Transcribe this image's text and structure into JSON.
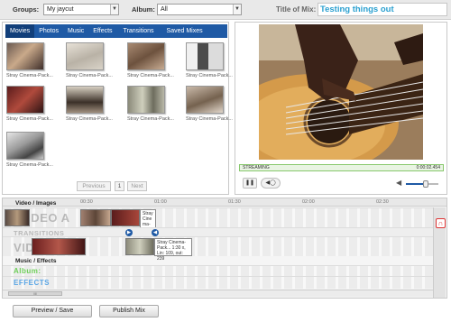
{
  "header": {
    "groups_label": "Groups:",
    "groups_value": "My jaycut",
    "album_label": "Album:",
    "album_value": "All",
    "mix_title_label": "Title of Mix:",
    "mix_title_value": "Testing things out"
  },
  "library": {
    "tabs": [
      "Movies",
      "Photos",
      "Music",
      "Effects",
      "Transitions",
      "Saved Mixes"
    ],
    "active_tab": "Movies",
    "items": [
      {
        "caption": "Stray Cinema-Pack..."
      },
      {
        "caption": "Stray Cinema-Pack..."
      },
      {
        "caption": "Stray Cinema-Pack..."
      },
      {
        "caption": "Stray Cinema-Pack..."
      },
      {
        "caption": "Stray Cinema-Pack..."
      },
      {
        "caption": "Stray Cinema-Pack..."
      },
      {
        "caption": "Stray Cinema-Pack..."
      },
      {
        "caption": "Stray Cinema-Pack..."
      },
      {
        "caption": "Stray Cinema-Pack..."
      }
    ],
    "pager": {
      "previous": "Previous",
      "page": "1",
      "next": "Next"
    }
  },
  "preview": {
    "status": "STREAMING",
    "time": "0:00:02.454",
    "volume_level": 0.6
  },
  "timeline": {
    "ticks": [
      "00:30",
      "01:00",
      "01:30",
      "02:00",
      "02:30"
    ],
    "tracks": {
      "video_images": "Video / Images",
      "music_effects": "Music / Effects"
    },
    "ghost_labels": {
      "video_a": "VIDEO A",
      "transitions": "TRANSITIONS",
      "video_b": "VIDEO B",
      "album": "Album:",
      "effects": "EFFECTS"
    },
    "tooltip_a": "Stray Cine ma-",
    "tooltip_b": "Stray Cinema-Pack... 1:30 x, Lin: 109, out: 239",
    "scroll_label": "III"
  },
  "actions": {
    "preview_save": "Preview / Save",
    "publish_mix": "Publish Mix"
  },
  "colors": {
    "tab_bar": "#1f5aa5",
    "mix_title": "#2aa0d0",
    "stream_bar": "#88c86d"
  }
}
